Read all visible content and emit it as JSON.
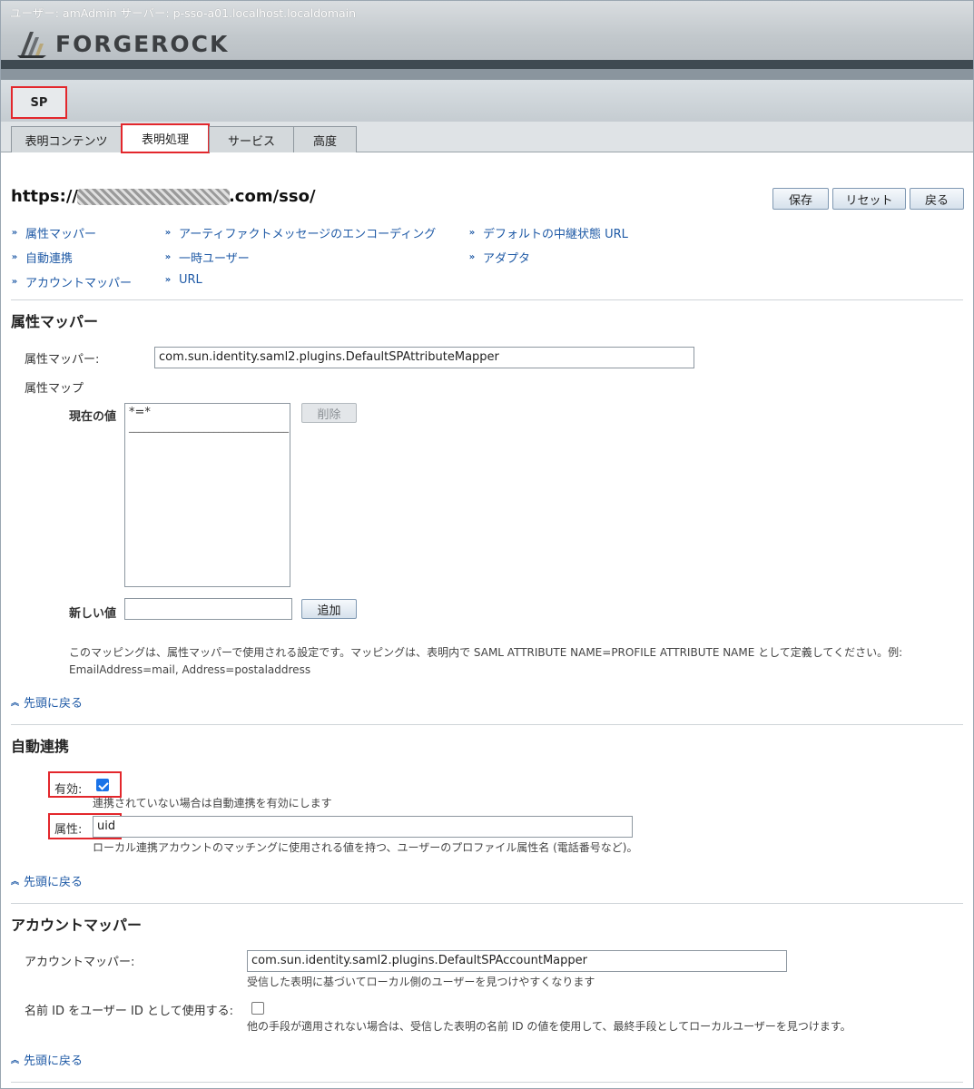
{
  "header": {
    "user_info": "ユーザー: amAdmin   サーバー: p-sso-a01.localhost.localdomain",
    "logo_text": "FORGEROCK"
  },
  "entity_tab": "SP",
  "tabs": [
    {
      "label": "表明コンテンツ",
      "active": false
    },
    {
      "label": "表明処理",
      "active": true
    },
    {
      "label": "サービス",
      "active": false
    },
    {
      "label": "高度",
      "active": false
    }
  ],
  "page": {
    "title_prefix": "https://",
    "title_suffix": ".com/sso/"
  },
  "buttons": {
    "save": "保存",
    "reset": "リセット",
    "back": "戻る"
  },
  "jump_links": {
    "col1": [
      "属性マッパー",
      "自動連携",
      "アカウントマッパー"
    ],
    "col2": [
      "アーティファクトメッセージのエンコーディング",
      "一時ユーザー",
      "URL"
    ],
    "col3": [
      "デフォルトの中継状態 URL",
      "アダプタ"
    ]
  },
  "attribute_mapper": {
    "section_title": "属性マッパー",
    "mapper_label": "属性マッパー:",
    "mapper_value": "com.sun.identity.saml2.plugins.DefaultSPAttributeMapper",
    "map_label": "属性マップ",
    "current_label": "現在の値",
    "current_items": [
      "*=*"
    ],
    "list_separator": "________________________________",
    "delete_button": "削除",
    "new_label": "新しい値",
    "new_value": "",
    "add_button": "追加",
    "help_line1": "このマッピングは、属性マッパーで使用される設定です。マッピングは、表明内で SAML ATTRIBUTE NAME=PROFILE ATTRIBUTE NAME として定義してください。例:",
    "help_line2": "EmailAddress=mail, Address=postaladdress",
    "top_link": "先頭に戻る"
  },
  "auto_federation": {
    "section_title": "自動連携",
    "enabled_label": "有効:",
    "enabled": true,
    "enabled_help": "連携されていない場合は自動連携を有効にします",
    "attribute_label": "属性:",
    "attribute_value": "uid",
    "attribute_help": "ローカル連携アカウントのマッチングに使用される値を持つ、ユーザーのプロファイル属性名 (電話番号など)。",
    "top_link": "先頭に戻る"
  },
  "account_mapper": {
    "section_title": "アカウントマッパー",
    "mapper_label": "アカウントマッパー:",
    "mapper_value": "com.sun.identity.saml2.plugins.DefaultSPAccountMapper",
    "mapper_help": "受信した表明に基づいてローカル側のユーザーを見つけやすくなります",
    "nameid_label": "名前 ID をユーザー ID として使用する:",
    "nameid_checked": false,
    "nameid_help": "他の手段が適用されない場合は、受信した表明の名前 ID の値を使用して、最終手段としてローカルユーザーを見つけます。",
    "top_link": "先頭に戻る"
  }
}
